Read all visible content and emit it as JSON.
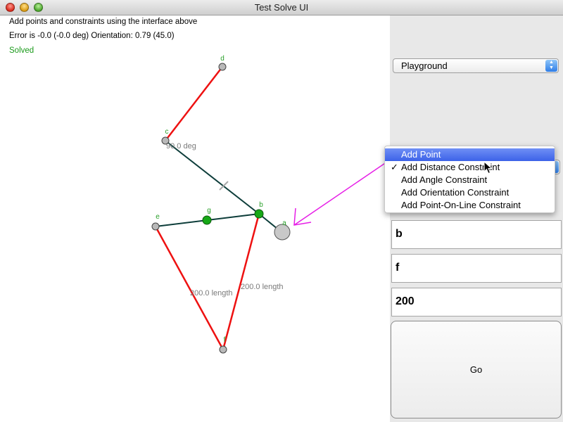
{
  "window": {
    "title": "Test Solve UI"
  },
  "info": {
    "instructions": "Add points and constraints using the interface above",
    "error_line": "Error is -0.0 (-0.0 deg) Orientation: 0.79 (45.0)",
    "status": "Solved"
  },
  "colors": {
    "status": "#1a9a1a",
    "label_green": "#2aa02a",
    "constraint_red": "#ee1111",
    "segment_dark": "#0d3d3a",
    "highlight": "#e61ee6",
    "constraint_text": "#7a7a7a"
  },
  "sidebar": {
    "scene_select": "Playground",
    "constraint_menu": {
      "items": [
        "Add Point",
        "Add Distance Constraint",
        "Add Angle Constraint",
        "Add Orientation Constraint",
        "Add Point-On-Line Constraint"
      ],
      "highlighted": "Add Point",
      "checked": "Add Distance Constraint"
    },
    "field1": "b",
    "field2": "f",
    "field3": "200",
    "go_label": "Go"
  },
  "sketch": {
    "points": [
      {
        "name": "d",
        "label": "d",
        "state": "normal"
      },
      {
        "name": "c",
        "label": "c",
        "state": "normal"
      },
      {
        "name": "b",
        "label": "b",
        "state": "selected"
      },
      {
        "name": "a",
        "label": "a",
        "state": "large"
      },
      {
        "name": "e",
        "label": "e",
        "state": "normal"
      },
      {
        "name": "g",
        "label": "g",
        "state": "selected"
      },
      {
        "name": "f",
        "label": "f",
        "state": "normal"
      }
    ],
    "constraint_labels": {
      "angle": "90.0 deg",
      "length_left": "200.0 length",
      "length_right": "200.0 length"
    }
  }
}
